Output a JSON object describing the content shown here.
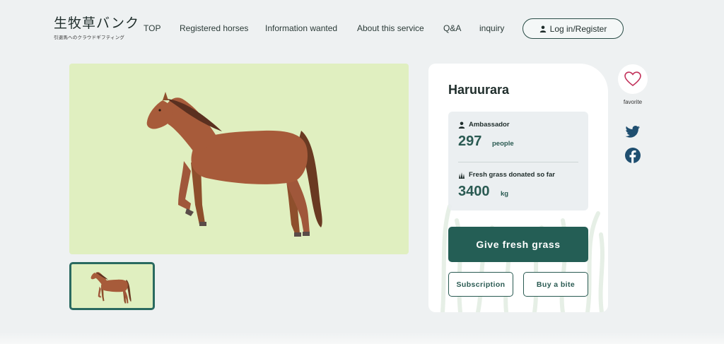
{
  "logo": {
    "title": "生牧草バンク",
    "subtitle": "引退馬へのクラウドギフティング"
  },
  "nav": {
    "items": [
      {
        "label": "TOP",
        "name": "nav-item-top"
      },
      {
        "label": "Registered horses",
        "name": "nav-item-registered-horses"
      },
      {
        "label": "Information wanted",
        "name": "nav-item-information-wanted"
      },
      {
        "label": "About this service",
        "name": "nav-item-about"
      },
      {
        "label": "Q&A",
        "name": "nav-item-qa"
      },
      {
        "label": "inquiry",
        "name": "nav-item-inquiry"
      }
    ],
    "login_label": "Log in/Register"
  },
  "horse": {
    "name": "Haruurara",
    "ambassador_label": "Ambassador",
    "ambassador_count": "297",
    "ambassador_unit": "people",
    "grass_label": "Fresh grass donated so far",
    "grass_amount": "3400",
    "grass_unit": "kg"
  },
  "actions": {
    "give_label": "Give fresh grass",
    "subscription_label": "Subscription",
    "bite_label": "Buy a bite"
  },
  "side": {
    "favorite_label": "favorite"
  },
  "colors": {
    "accent": "#245e55",
    "image_bg": "#e0efc0",
    "page_bg": "#eef1f2",
    "heart": "#c2315a",
    "social": "#1f4f70"
  }
}
